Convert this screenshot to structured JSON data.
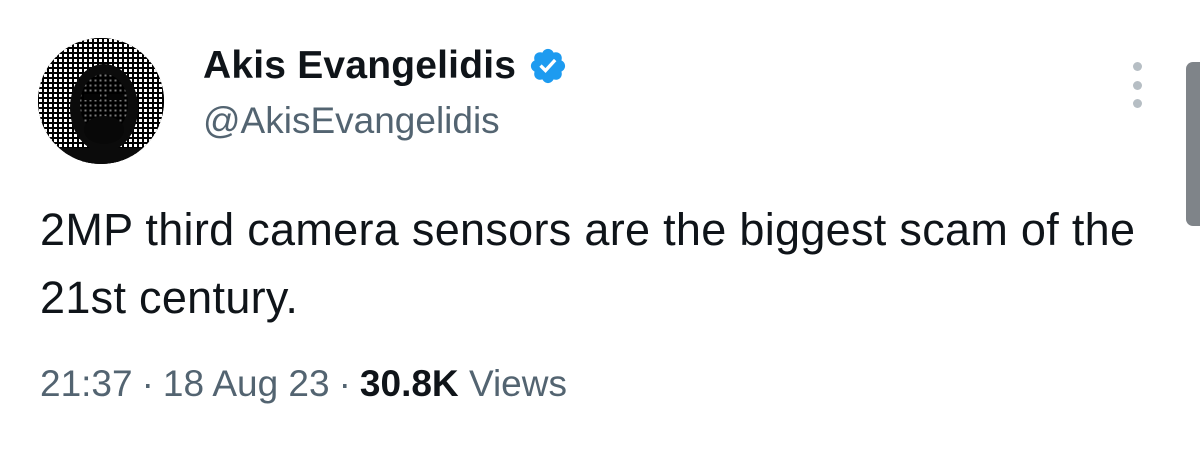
{
  "author": {
    "display_name": "Akis Evangelidis",
    "handle": "@AkisEvangelidis",
    "verified": true,
    "verified_color": "#1d9bf0"
  },
  "tweet": {
    "text": "2MP third camera sensors are the biggest scam of the 21st century.",
    "time": "21:37",
    "date": "18 Aug 23",
    "views_count": "30.8K",
    "views_label": "Views",
    "separator": "·"
  },
  "icons": {
    "more": "more-vertical-icon",
    "verified": "verified-badge-icon"
  },
  "colors": {
    "primary_text": "#0f1419",
    "secondary_text": "#536471",
    "background": "#ffffff"
  }
}
